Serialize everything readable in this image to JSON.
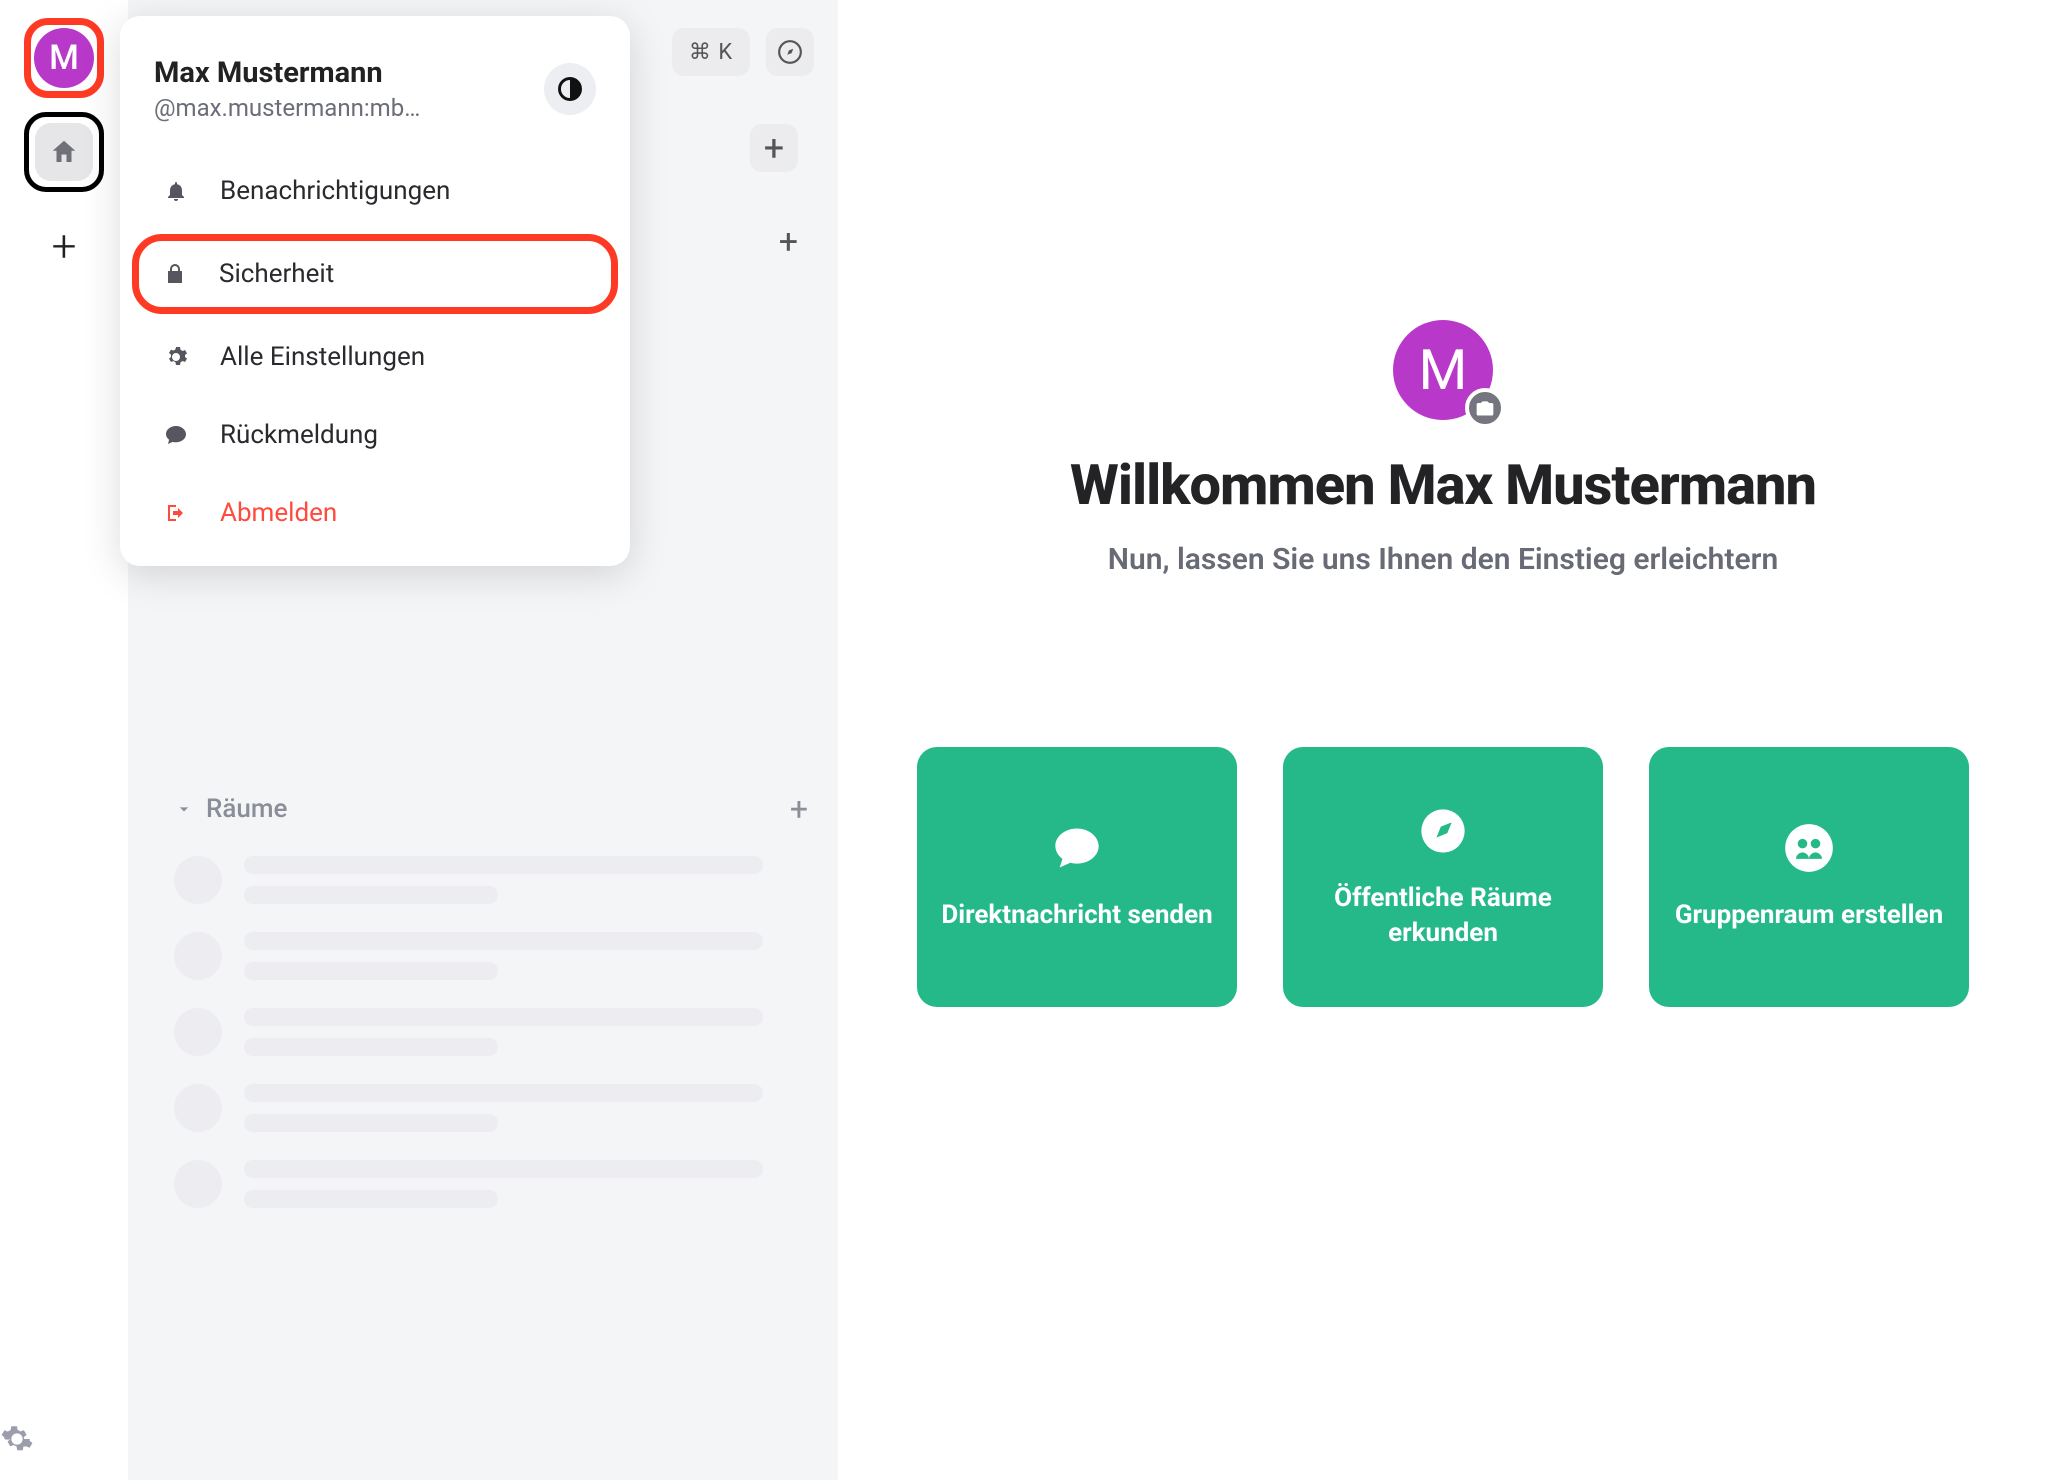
{
  "rail": {
    "avatar_letter": "M",
    "plus": "+"
  },
  "top": {
    "kbd_hint": "⌘ K"
  },
  "popover": {
    "name": "Max Mustermann",
    "handle": "@max.mustermann:mb…",
    "items": {
      "notifications": "Benachrichtigungen",
      "security": "Sicherheit",
      "all_settings": "Alle Einstellungen",
      "feedback": "Rückmeldung",
      "signout": "Abmelden"
    }
  },
  "sidebar": {
    "rooms_header": "Räume"
  },
  "main": {
    "avatar_letter": "M",
    "welcome": "Willkommen Max Mustermann",
    "subtitle": "Nun, lassen Sie uns Ihnen den Einstieg erleichtern",
    "cards": [
      {
        "label": "Direktnachricht senden"
      },
      {
        "label": "Öffentliche Räume erkunden"
      },
      {
        "label": "Gruppenraum erstellen"
      }
    ]
  },
  "colors": {
    "accent": "#25b989",
    "avatar": "#b838c9",
    "danger": "#ff4b3e",
    "highlight_red": "#ff3a24"
  }
}
